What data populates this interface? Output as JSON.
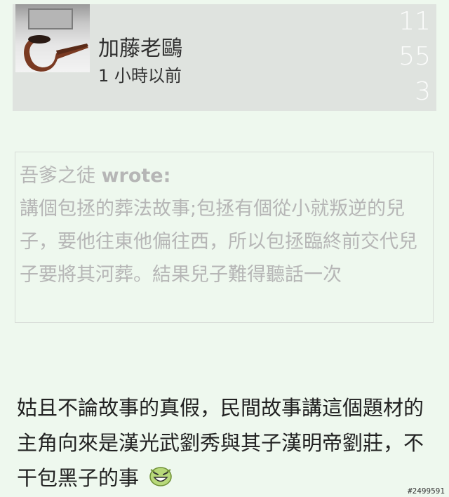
{
  "post": {
    "author": "加藤老鷗",
    "time": "1 小時以前",
    "side_numbers": [
      "11",
      "55",
      "3"
    ]
  },
  "quote": {
    "author_name": "吾爹之徒",
    "wrote_label": "wrote:",
    "text": "講個包拯的葬法故事;包拯有個從小就叛逆的兒子，要他往東他偏往西，所以包拯臨終前交代兒子要將其河葬。結果兒子難得聽話一次"
  },
  "reply": {
    "text": "姑且不論故事的真假，民間故事講這個題材的主角向來是漢光武劉秀與其子漢明帝劉莊，不干包黑子的事",
    "emoji": "grinning-face-icon"
  },
  "footer": {
    "post_id": "#2499591"
  },
  "colors": {
    "background": "#eef8ee",
    "header_bg": "#dfe3df",
    "quote_text": "#b6b6b6"
  }
}
